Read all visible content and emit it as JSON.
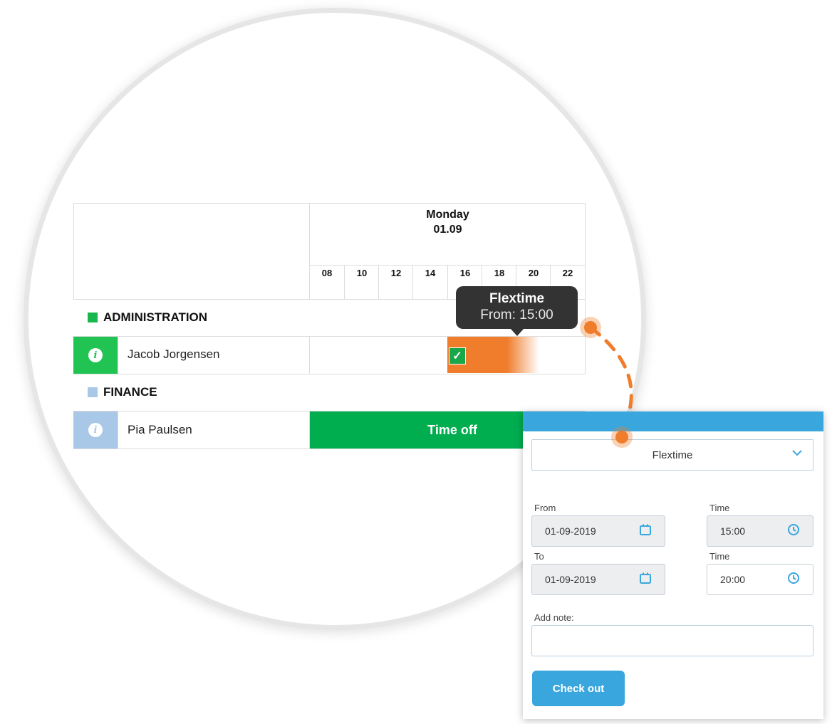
{
  "schedule": {
    "day": "Monday",
    "date": "01.09",
    "hours": [
      "08",
      "10",
      "12",
      "14",
      "16",
      "18",
      "20",
      "22"
    ],
    "groups": [
      {
        "name": "ADMINISTRATION",
        "color": "#18b84c",
        "employee": {
          "name": "Jacob Jorgensen",
          "info_color": "#21c452"
        }
      },
      {
        "name": "FINANCE",
        "color": "#a9c8e8",
        "employee": {
          "name": "Pia Paulsen",
          "info_color": "#a9c8e8"
        }
      }
    ],
    "flex_block_color": "#ef7d2b",
    "time_off_label": "Time off",
    "time_off_color": "#00ad4f"
  },
  "tooltip": {
    "title": "Flextime",
    "subtitle": "From: 15:00"
  },
  "panel": {
    "type_value": "Flextime",
    "from_label": "From",
    "from_date": "01-09-2019",
    "from_time_label": "Time",
    "from_time": "15:00",
    "to_label": "To",
    "to_date": "01-09-2019",
    "to_time_label": "Time",
    "to_time": "20:00",
    "note_label": "Add note:",
    "note_value": "",
    "button_label": "Check out",
    "accent_color": "#3aa6de"
  },
  "icons": {
    "info": "info-icon",
    "check": "checkmark-icon",
    "calendar": "calendar-icon",
    "clock": "clock-icon",
    "chevron": "chevron-down-icon"
  }
}
